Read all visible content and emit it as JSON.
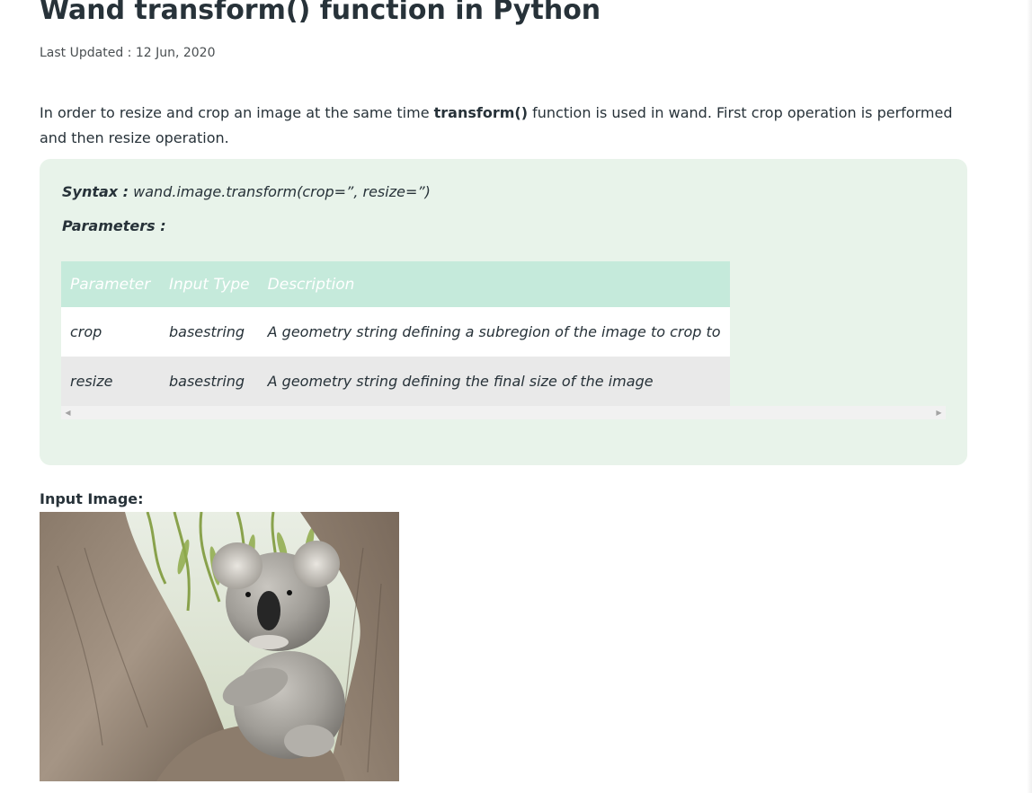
{
  "article": {
    "title": "Wand transform() function in Python",
    "last_updated": "Last Updated : 12 Jun, 2020",
    "intro_before": "In order to resize and crop an image at the same time ",
    "intro_bold": "transform()",
    "intro_after": " function is used in wand. First crop operation is performed and then resize operation."
  },
  "syntax": {
    "label": "Syntax :",
    "signature": " wand.image.transform(crop=”, resize=”)",
    "parameters_heading": "Parameters :"
  },
  "param_table": {
    "headers": [
      "Parameter",
      "Input Type",
      "Description"
    ],
    "rows": [
      [
        "crop",
        "basestring",
        "A geometry string defining a subregion of the image to crop to"
      ],
      [
        "resize",
        "basestring",
        "A geometry string defining the final size of the image"
      ]
    ]
  },
  "scrollbar": {
    "left_icon": "triangle-left-icon",
    "right_icon": "triangle-right-icon"
  },
  "input_image": {
    "label": "Input Image:",
    "subject": "koala in tree"
  },
  "colors": {
    "syntax_bg": "#e8f3ea",
    "table_header_bg": "#c5eadb",
    "text": "#273239"
  }
}
